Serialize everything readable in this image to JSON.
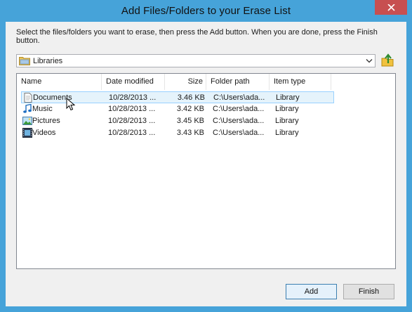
{
  "window": {
    "title": "Add Files/Folders to your Erase List",
    "close_glyph": "✕"
  },
  "instruction": "Select the files/folders you want to erase, then press the Add button. When you are done, press the Finish button.",
  "location": {
    "value": "Libraries",
    "icon": "folder-icon"
  },
  "list": {
    "columns": [
      {
        "label": "Name"
      },
      {
        "label": "Date modified"
      },
      {
        "label": "Size"
      },
      {
        "label": "Folder path"
      },
      {
        "label": "Item type"
      }
    ],
    "rows": [
      {
        "name": "Documents",
        "date": "10/28/2013 ...",
        "size": "3.46 KB",
        "path": "C:\\Users\\ada...",
        "type": "Library",
        "icon": "documents-library-icon"
      },
      {
        "name": "Music",
        "date": "10/28/2013 ...",
        "size": "3.42 KB",
        "path": "C:\\Users\\ada...",
        "type": "Library",
        "icon": "music-library-icon"
      },
      {
        "name": "Pictures",
        "date": "10/28/2013 ...",
        "size": "3.45 KB",
        "path": "C:\\Users\\ada...",
        "type": "Library",
        "icon": "pictures-library-icon"
      },
      {
        "name": "Videos",
        "date": "10/28/2013 ...",
        "size": "3.43 KB",
        "path": "C:\\Users\\ada...",
        "type": "Library",
        "icon": "videos-library-icon"
      }
    ]
  },
  "buttons": {
    "add": "Add",
    "finish": "Finish"
  },
  "colors": {
    "title_bar": "#46a3d9",
    "close_button": "#c74f50",
    "selection_border": "#99d1ff"
  }
}
